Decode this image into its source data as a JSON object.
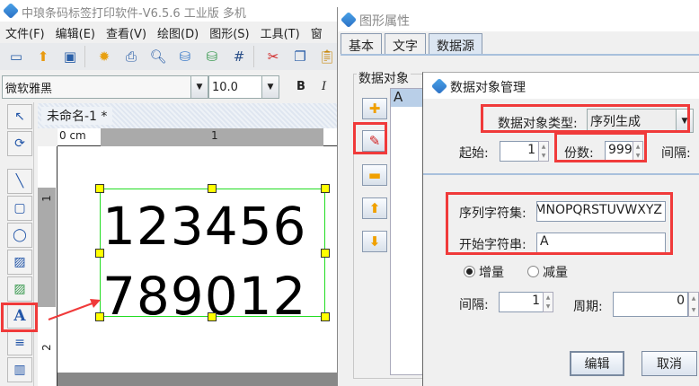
{
  "app": {
    "title": "中琅条码标签打印软件-V6.5.6 工业版 多机"
  },
  "menu": [
    "文件(F)",
    "编辑(E)",
    "查看(V)",
    "绘图(D)",
    "图形(S)",
    "工具(T)",
    "窗"
  ],
  "toolbar": [
    "new-window-icon",
    "open-icon",
    "save-icon",
    "settings-icon",
    "print-icon",
    "print-preview-icon",
    "database-icon",
    "database-connect-icon",
    "grid-icon",
    "cut-icon",
    "copy-icon",
    "paste-icon"
  ],
  "fontbar": {
    "font": "微软雅黑",
    "size": "10.0",
    "bold": "B",
    "italic": "I"
  },
  "document": {
    "tab": "未命名-1 *",
    "ruler_h_labels": [
      "0 cm",
      "1"
    ],
    "ruler_v_labels": [
      "1",
      "2"
    ],
    "text_lines": [
      "123456",
      "789012"
    ]
  },
  "props_dialog": {
    "title": "图形属性",
    "tabs": [
      "基本",
      "文字",
      "数据源"
    ],
    "active_tab": "数据源",
    "group": "数据对象",
    "list": [
      "A"
    ]
  },
  "manager_dialog": {
    "title": "数据对象管理",
    "type_label": "数据对象类型:",
    "type_value": "序列生成",
    "start_label": "起始:",
    "start_value": "1",
    "copies_label": "份数:",
    "copies_value": "999",
    "interval_label_top": "间隔:",
    "charset_label": "序列字符集:",
    "charset_value": "MNOPQRSTUVWXYZ",
    "start_string_label": "开始字符串:",
    "start_string_value": "A",
    "increment_label": "增量",
    "decrement_label": "减量",
    "mode": "增量",
    "interval_label": "间隔:",
    "interval_value": "1",
    "period_label": "周期:",
    "period_value": "0",
    "edit_button": "编辑",
    "cancel_button": "取消"
  },
  "colors": {
    "highlight": "#f03a3a",
    "selection": "#22dd22",
    "handle": "#ffff00"
  }
}
